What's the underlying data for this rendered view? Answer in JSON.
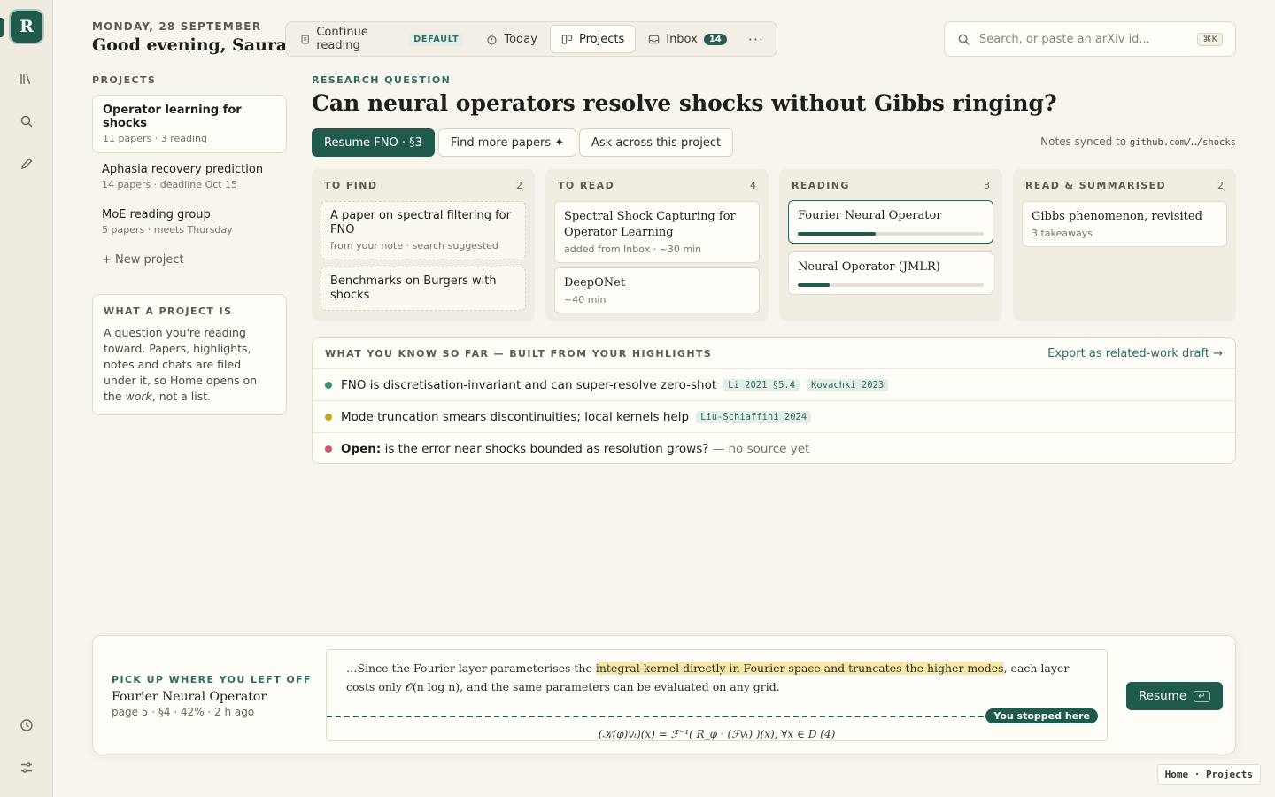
{
  "app": {
    "logo_letter": "R"
  },
  "header": {
    "date": "MONDAY, 28 SEPTEMBER",
    "greeting": "Good evening, Saurav",
    "tabs": [
      {
        "label": "Continue reading",
        "tag": "DEFAULT",
        "icon": "document-icon"
      },
      {
        "label": "Today",
        "icon": "timer-icon"
      },
      {
        "label": "Projects",
        "icon": "board-icon",
        "active": true
      },
      {
        "label": "Inbox",
        "badge": "14",
        "icon": "inbox-icon"
      }
    ],
    "more": "···",
    "search": {
      "placeholder": "Search, or paste an arXiv id...",
      "shortcut": "⌘K"
    }
  },
  "sidebar": {
    "label": "PROJECTS",
    "projects": [
      {
        "title": "Operator learning for shocks",
        "meta": "11 papers · 3 reading",
        "active": true
      },
      {
        "title": "Aphasia recovery prediction",
        "meta": "14 papers · deadline Oct 15"
      },
      {
        "title": "MoE reading group",
        "meta": "5 papers · meets Thursday"
      }
    ],
    "new_project": "+ New project",
    "explainer": {
      "title": "WHAT A PROJECT IS",
      "body_1": "A question you're reading toward. Papers, highlights, notes and chats are filed under it, so Home opens on the ",
      "body_em": "work",
      "body_2": ", not a list."
    }
  },
  "main": {
    "rq_label": "RESEARCH QUESTION",
    "rq_title": "Can neural operators resolve shocks without Gibbs ringing?",
    "actions": {
      "resume": "Resume FNO · §3",
      "find": "Find more papers ✦",
      "ask": "Ask across this project"
    },
    "synced_prefix": "Notes synced to",
    "synced_repo": "github.com/…/shocks",
    "columns": [
      {
        "name": "TO FIND",
        "count": "2",
        "cards": [
          {
            "title": "A paper on spectral filtering for FNO",
            "meta": "from your note · search suggested"
          },
          {
            "title": "Benchmarks on Burgers with shocks",
            "meta": ""
          }
        ]
      },
      {
        "name": "TO READ",
        "count": "4",
        "cards": [
          {
            "title": "Spectral Shock Capturing for Operator Learning",
            "meta": "added from Inbox · ~30 min"
          },
          {
            "title": "DeepONet",
            "meta": "~40 min"
          }
        ]
      },
      {
        "name": "READING",
        "count": "3",
        "cards": [
          {
            "title": "Fourier Neural Operator",
            "progress": 0.42
          },
          {
            "title": "Neural Operator (JMLR)",
            "progress": 0.17
          }
        ]
      },
      {
        "name": "READ & SUMMARISED",
        "count": "2",
        "cards": [
          {
            "title": "Gibbs phenomenon, revisited",
            "meta": "3 takeaways"
          }
        ]
      }
    ],
    "knowledge": {
      "title": "WHAT YOU KNOW SO FAR — BUILT FROM YOUR HIGHLIGHTS",
      "export": "Export as related-work draft →",
      "rows": [
        {
          "color": "#3f8f6f",
          "text": "FNO is discretisation-invariant and can super-resolve zero-shot",
          "cites": [
            "Li 2021 §5.4",
            "Kovachki 2023"
          ]
        },
        {
          "color": "#c9a227",
          "text": "Mode truncation smears discontinuities; local kernels help",
          "cites": [
            "Liu-Schiaffini 2024"
          ]
        },
        {
          "color": "#c95a6a",
          "open_label": "Open:",
          "text": " is the error near shocks bounded as resolution grows?",
          "tail": " — no source yet"
        }
      ]
    }
  },
  "resume_panel": {
    "label": "PICK UP WHERE YOU LEFT OFF",
    "paper": "Fourier Neural Operator",
    "meta": "page 5 · §4 · 42% · 2 h ago",
    "excerpt_pre": "…Since the Fourier layer parameterises the ",
    "excerpt_hl": "integral kernel directly in Fourier space and truncates the higher modes",
    "excerpt_post": ", each layer costs only 𝒪(n log n), and the same parameters can be evaluated on any grid.",
    "stop_tag": "You stopped here",
    "formula": "(𝒦(φ)vₜ)(x) = ℱ⁻¹( R_φ · (ℱvₜ) )(x),  ∀x ∈ D   (4)",
    "button": "Resume",
    "enter_key": "↵"
  },
  "breadcrumb": "Home · Projects"
}
